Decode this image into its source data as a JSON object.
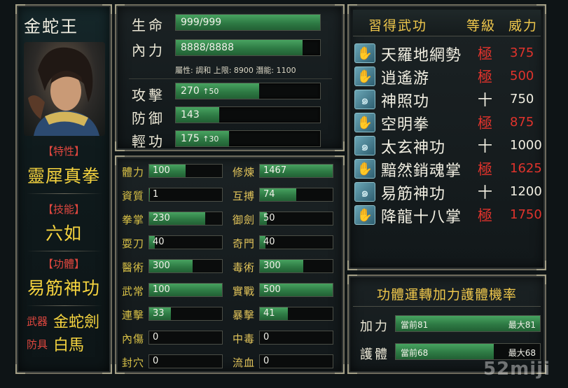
{
  "character": {
    "name": "金蛇王",
    "trait_title": "【特性】",
    "trait_value": "靈犀真拳",
    "skill_title": "【技能】",
    "skill_value": "六如",
    "body_title": "【功體】",
    "body_value": "易筋神功",
    "weapon_label": "武器",
    "weapon_value": "金蛇劍",
    "armor_label": "防具",
    "armor_value": "白馬"
  },
  "core": {
    "hp_label": "生命",
    "hp_text": "999/999",
    "hp_fraction": 1.0,
    "mp_label": "內力",
    "mp_text": "8888/8888",
    "mp_fraction": 0.88,
    "note": "屬性: 調和 上限: 8900 潛能: 1100",
    "atk_label": "攻擊",
    "atk_text": "270",
    "atk_bonus": "↑50",
    "atk_fraction": 0.58,
    "def_label": "防御",
    "def_text": "143",
    "def_fraction": 0.3,
    "agi_label": "輕功",
    "agi_text": "175",
    "agi_bonus": "↑30",
    "agi_fraction": 0.37
  },
  "attributes": [
    {
      "label": "體力",
      "value": "100",
      "fraction": 0.5
    },
    {
      "label": "修煉",
      "value": "1467",
      "fraction": 1.0
    },
    {
      "label": "資質",
      "value": "1",
      "fraction": 0.01
    },
    {
      "label": "互搏",
      "value": "74",
      "fraction": 0.5
    },
    {
      "label": "拳掌",
      "value": "230",
      "fraction": 0.77
    },
    {
      "label": "御劍",
      "value": "50",
      "fraction": 0.1
    },
    {
      "label": "耍刀",
      "value": "40",
      "fraction": 0.08
    },
    {
      "label": "奇門",
      "value": "40",
      "fraction": 0.08
    },
    {
      "label": "醫術",
      "value": "300",
      "fraction": 0.6
    },
    {
      "label": "毒術",
      "value": "300",
      "fraction": 0.6
    },
    {
      "label": "武常",
      "value": "100",
      "fraction": 1.0
    },
    {
      "label": "實戰",
      "value": "500",
      "fraction": 1.0
    },
    {
      "label": "連擊",
      "value": "33",
      "fraction": 0.3
    },
    {
      "label": "暴擊",
      "value": "41",
      "fraction": 0.38
    },
    {
      "label": "內傷",
      "value": "0",
      "fraction": 0
    },
    {
      "label": "中毒",
      "value": "0",
      "fraction": 0
    },
    {
      "label": "封穴",
      "value": "0",
      "fraction": 0
    },
    {
      "label": "流血",
      "value": "0",
      "fraction": 0
    }
  ],
  "skills": {
    "header_name": "習得武功",
    "header_level": "等級",
    "header_power": "威力",
    "rows": [
      {
        "name": "天羅地網勢",
        "level": "極",
        "power": "375",
        "max": true,
        "icon": "palm-icon"
      },
      {
        "name": "逍遙游",
        "level": "極",
        "power": "500",
        "max": true,
        "icon": "palm-icon"
      },
      {
        "name": "神照功",
        "level": "十",
        "power": "750",
        "max": false,
        "icon": "swirl-icon"
      },
      {
        "name": "空明拳",
        "level": "極",
        "power": "875",
        "max": true,
        "icon": "palm-icon"
      },
      {
        "name": "太玄神功",
        "level": "十",
        "power": "1000",
        "max": false,
        "icon": "swirl-icon"
      },
      {
        "name": "黯然銷魂掌",
        "level": "極",
        "power": "1625",
        "max": true,
        "icon": "palm-icon"
      },
      {
        "name": "易筋神功",
        "level": "十",
        "power": "1200",
        "max": false,
        "icon": "swirl-icon"
      },
      {
        "name": "降龍十八掌",
        "level": "極",
        "power": "1750",
        "max": true,
        "icon": "palm-icon"
      }
    ]
  },
  "boost": {
    "title": "功體運轉加力護體機率",
    "power_label": "加力",
    "power_current": "當前81",
    "power_max": "最大81",
    "power_fraction": 1.0,
    "guard_label": "護體",
    "guard_current": "當前68",
    "guard_max": "最大68",
    "guard_fraction": 0.68
  },
  "colors": {
    "accent_gold": "#f6d43f",
    "accent_red": "#e0473f",
    "bar_green": "#2e7a44"
  },
  "watermark": "52miji"
}
